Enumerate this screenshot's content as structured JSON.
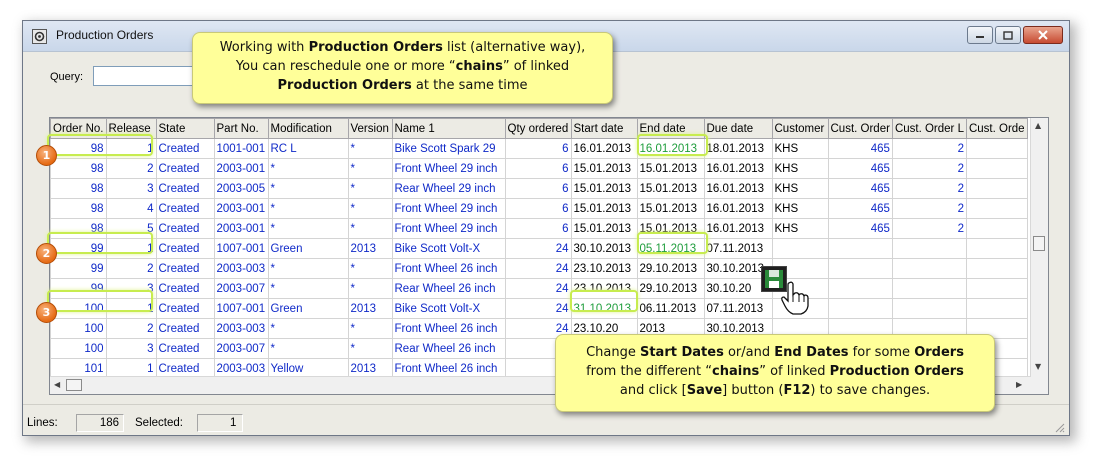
{
  "window": {
    "title": "Production Orders",
    "icon": "gear-window-icon"
  },
  "query": {
    "label": "Query:",
    "value": ""
  },
  "columns": [
    "Order No.",
    "Release",
    "State",
    "Part No.",
    "Modification",
    "Version",
    "Name 1",
    "Qty ordered",
    "Start date",
    "End date",
    "Due date",
    "Customer",
    "Cust. Order",
    "Cust. Order L",
    "Cust. Orde"
  ],
  "rows": [
    [
      "98",
      "1",
      "Created",
      "1001-001",
      "RC L",
      "*",
      "Bike Scott Spark 29",
      "6",
      "16.01.2013",
      "16.01.2013",
      "18.01.2013",
      "KHS",
      "465",
      "2",
      ""
    ],
    [
      "98",
      "2",
      "Created",
      "2003-001",
      "*",
      "*",
      "Front Wheel 29 inch",
      "6",
      "15.01.2013",
      "15.01.2013",
      "16.01.2013",
      "KHS",
      "465",
      "2",
      ""
    ],
    [
      "98",
      "3",
      "Created",
      "2003-005",
      "*",
      "*",
      "Rear Wheel 29 inch",
      "6",
      "15.01.2013",
      "15.01.2013",
      "16.01.2013",
      "KHS",
      "465",
      "2",
      ""
    ],
    [
      "98",
      "4",
      "Created",
      "2003-001",
      "*",
      "*",
      "Front Wheel 29 inch",
      "6",
      "15.01.2013",
      "15.01.2013",
      "16.01.2013",
      "KHS",
      "465",
      "2",
      ""
    ],
    [
      "98",
      "5",
      "Created",
      "2003-001",
      "*",
      "*",
      "Front Wheel 29 inch",
      "6",
      "15.01.2013",
      "15.01.2013",
      "16.01.2013",
      "KHS",
      "465",
      "2",
      ""
    ],
    [
      "99",
      "1",
      "Created",
      "1007-001",
      "Green",
      "2013",
      "Bike Scott Volt-X",
      "24",
      "30.10.2013",
      "05.11.2013",
      "07.11.2013",
      "",
      "",
      "",
      ""
    ],
    [
      "99",
      "2",
      "Created",
      "2003-003",
      "*",
      "*",
      "Front Wheel 26 inch",
      "24",
      "23.10.2013",
      "29.10.2013",
      "30.10.2013",
      "",
      "",
      "",
      ""
    ],
    [
      "99",
      "3",
      "Created",
      "2003-007",
      "*",
      "*",
      "Rear Wheel 26 inch",
      "24",
      "23.10.2013",
      "29.10.2013",
      "30.10.20",
      "",
      "",
      "",
      ""
    ],
    [
      "100",
      "1",
      "Created",
      "1007-001",
      "Green",
      "2013",
      "Bike Scott Volt-X",
      "24",
      "31.10.2013",
      "06.11.2013",
      "07.11.2013",
      "",
      "",
      "",
      ""
    ],
    [
      "100",
      "2",
      "Created",
      "2003-003",
      "*",
      "*",
      "Front Wheel 26 inch",
      "24",
      "23.10.20",
      "2013",
      "30.10.2013",
      "",
      "",
      "",
      ""
    ],
    [
      "100",
      "3",
      "Created",
      "2003-007",
      "*",
      "*",
      "Rear Wheel 26 inch",
      "",
      "",
      "",
      "",
      "",
      "",
      "",
      ""
    ],
    [
      "101",
      "1",
      "Created",
      "2003-003",
      "Yellow",
      "2013",
      "Front Wheel 26 inch",
      "",
      "",
      "",
      "",
      "",
      "",
      "",
      ""
    ]
  ],
  "status": {
    "lines_label": "Lines:",
    "lines_value": "186",
    "selected_label": "Selected:",
    "selected_value": "1"
  },
  "callout_top": {
    "line1_a": "Working with ",
    "line1_b": "Production Orders",
    "line1_c": " list (alternative way),",
    "line2_a": "You can reschedule one or more “",
    "line2_b": "chains",
    "line2_c": "” of linked",
    "line3_a": "Production Orders",
    "line3_b": " at the same time"
  },
  "callout_bottom": {
    "line1_a": "Change ",
    "line1_b": "Start Dates",
    "line1_c": " or/and ",
    "line1_d": "End Dates",
    "line1_e": " for some ",
    "line1_f": "Orders",
    "line2_a": "from the different “",
    "line2_b": "chains",
    "line2_c": "” of linked ",
    "line2_d": "Production Orders",
    "line3_a": "and click [",
    "line3_b": "Save",
    "line3_c": "] button (",
    "line3_d": "F12",
    "line3_e": ") to save changes."
  },
  "badges": [
    "1",
    "2",
    "3"
  ],
  "colors": {
    "cell_text": "#0f29c8",
    "changed_date": "#1f9d3c",
    "highlight": "#c7ec4f",
    "callout_bg": "#ffff99",
    "badge": "#e66b14"
  }
}
